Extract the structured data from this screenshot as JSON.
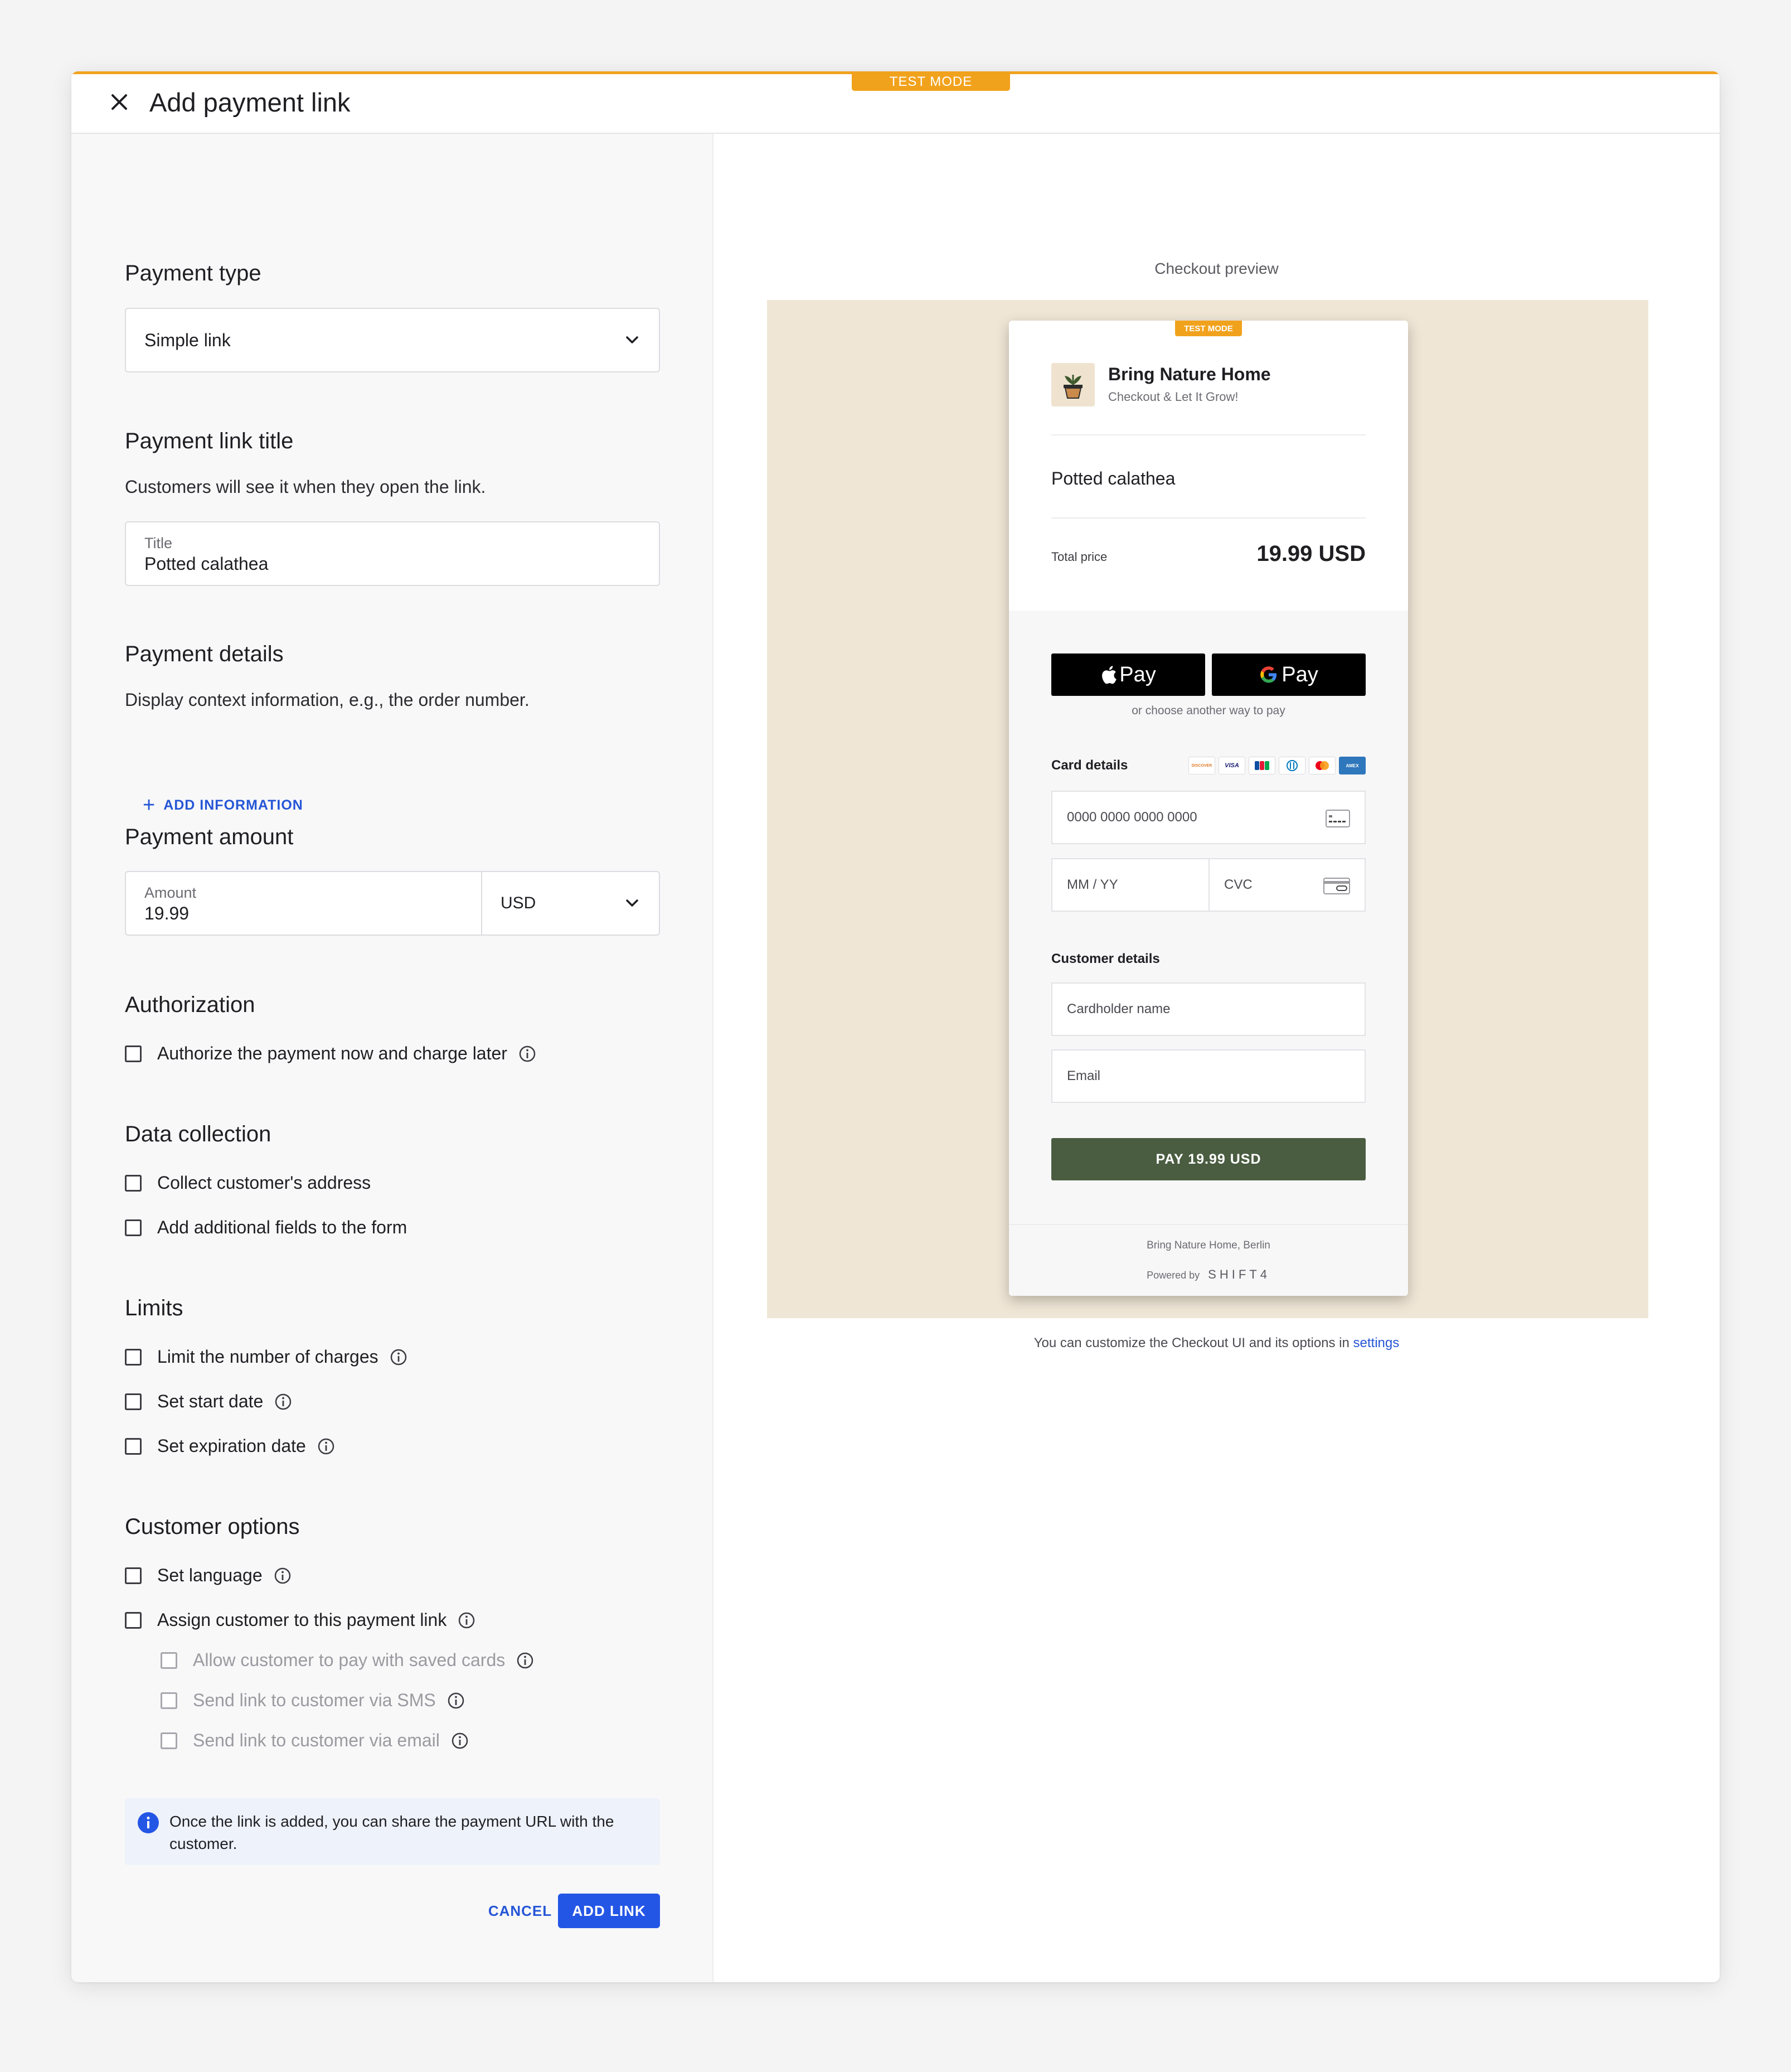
{
  "header": {
    "title": "Add payment link",
    "test_mode": "TEST MODE"
  },
  "form": {
    "payment_type": {
      "title": "Payment type",
      "value": "Simple link"
    },
    "link_title": {
      "title": "Payment link title",
      "desc": "Customers will see it when they open the link.",
      "field_label": "Title",
      "field_value": "Potted calathea"
    },
    "payment_details": {
      "title": "Payment details",
      "desc": "Display context information, e.g., the order number.",
      "add_label": "ADD INFORMATION"
    },
    "payment_amount": {
      "title": "Payment amount",
      "field_label": "Amount",
      "field_value": "19.99",
      "currency": "USD"
    },
    "authorization": {
      "title": "Authorization",
      "items": [
        "Authorize the payment now and charge later"
      ]
    },
    "data_collection": {
      "title": "Data collection",
      "items": [
        "Collect customer's address",
        "Add additional fields to the form"
      ]
    },
    "limits": {
      "title": "Limits",
      "items": [
        "Limit the number of charges",
        "Set start date",
        "Set expiration date"
      ]
    },
    "customer_options": {
      "title": "Customer options",
      "items": [
        "Set language",
        "Assign customer to this payment link"
      ],
      "sub_items": [
        "Allow customer to pay with saved cards",
        "Send link to customer via SMS",
        "Send link to customer via email"
      ]
    },
    "notice": "Once the link is added, you can share the payment URL with the customer.",
    "cancel_label": "CANCEL",
    "add_label": "ADD LINK"
  },
  "preview": {
    "label": "Checkout preview",
    "test_mode": "TEST MODE",
    "merchant_name": "Bring Nature Home",
    "merchant_tagline": "Checkout & Let It Grow!",
    "product": "Potted calathea",
    "total_label": "Total price",
    "total_value": "19.99 USD",
    "apple_pay": "Pay",
    "google_pay": "Pay",
    "or_text": "or choose another way to pay",
    "card_details_label": "Card details",
    "card_brands": [
      "DISCOVER",
      "VISA",
      "JCB",
      "DINERS",
      "MASTERCARD",
      "AMEX"
    ],
    "card_number_placeholder": "0000 0000 0000 0000",
    "expiry_placeholder": "MM / YY",
    "cvc_placeholder": "CVC",
    "customer_details_label": "Customer details",
    "cardholder_placeholder": "Cardholder name",
    "email_placeholder": "Email",
    "pay_button": "PAY 19.99 USD",
    "footer_address": "Bring Nature Home, Berlin",
    "powered_by": "Powered by",
    "powered_brand": "SHIFT4",
    "customize_text": "You can customize the Checkout UI and its options in",
    "customize_link": "settings"
  },
  "colors": {
    "accent": "#2456e6",
    "test_mode": "#f1a21c",
    "preview_bg": "#f0e6d6",
    "pay_button": "#4a5d41"
  }
}
